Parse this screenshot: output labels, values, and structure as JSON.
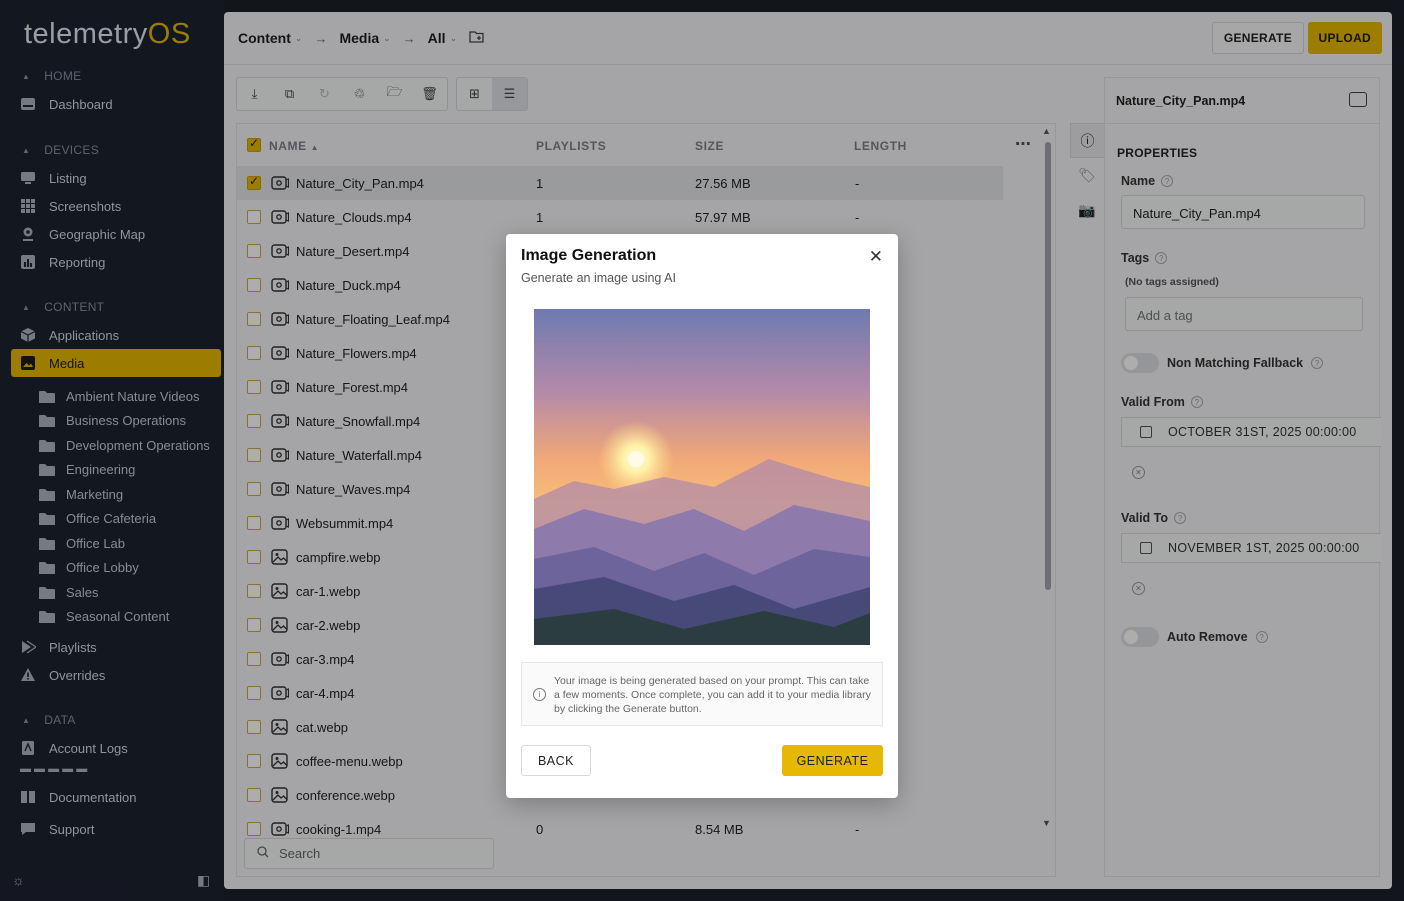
{
  "sidebar": {
    "logo_main": "telemetry",
    "logo_os": "OS",
    "sections": {
      "home": "HOME",
      "devices": "DEVICES",
      "content": "CONTENT",
      "data": "DATA"
    },
    "items": {
      "dashboard": "Dashboard",
      "listing": "Listing",
      "screenshots": "Screenshots",
      "geomap": "Geographic Map",
      "reporting": "Reporting",
      "applications": "Applications",
      "media": "Media",
      "playlists": "Playlists",
      "overrides": "Overrides",
      "account_logs": "Account Logs",
      "documentation": "Documentation",
      "support": "Support"
    },
    "folders": [
      "Ambient Nature Videos",
      "Business Operations",
      "Development Operations",
      "Engineering",
      "Marketing",
      "Office Cafeteria",
      "Office Lab",
      "Office Lobby",
      "Sales",
      "Seasonal Content"
    ]
  },
  "topbar": {
    "crumb_content": "Content",
    "crumb_media": "Media",
    "crumb_all": "All",
    "generate_label": "GENERATE",
    "upload_label": "UPLOAD"
  },
  "table": {
    "headers": {
      "name": "NAME",
      "playlists": "PLAYLISTS",
      "size": "SIZE",
      "length": "LENGTH"
    },
    "rows": [
      {
        "name": "Nature_City_Pan.mp4",
        "playlists": "1",
        "size": "27.56 MB",
        "length": "-",
        "type": "video",
        "selected": true
      },
      {
        "name": "Nature_Clouds.mp4",
        "playlists": "1",
        "size": "57.97 MB",
        "length": "-",
        "type": "video"
      },
      {
        "name": "Nature_Desert.mp4",
        "type": "video"
      },
      {
        "name": "Nature_Duck.mp4",
        "type": "video"
      },
      {
        "name": "Nature_Floating_Leaf.mp4",
        "type": "video"
      },
      {
        "name": "Nature_Flowers.mp4",
        "type": "video"
      },
      {
        "name": "Nature_Forest.mp4",
        "type": "video"
      },
      {
        "name": "Nature_Snowfall.mp4",
        "type": "video"
      },
      {
        "name": "Nature_Waterfall.mp4",
        "type": "video"
      },
      {
        "name": "Nature_Waves.mp4",
        "type": "video"
      },
      {
        "name": "Websummit.mp4",
        "type": "video"
      },
      {
        "name": "campfire.webp",
        "type": "image"
      },
      {
        "name": "car-1.webp",
        "type": "image"
      },
      {
        "name": "car-2.webp",
        "type": "image"
      },
      {
        "name": "car-3.mp4",
        "type": "video"
      },
      {
        "name": "car-4.mp4",
        "type": "video"
      },
      {
        "name": "cat.webp",
        "type": "image"
      },
      {
        "name": "coffee-menu.webp",
        "type": "image"
      },
      {
        "name": "conference.webp",
        "type": "image"
      },
      {
        "name": "cooking-1.mp4",
        "playlists": "0",
        "size": "8.54 MB",
        "length": "-",
        "type": "video"
      }
    ]
  },
  "search": {
    "placeholder": "Search"
  },
  "properties": {
    "file_title": "Nature_City_Pan.mp4",
    "section_title": "PROPERTIES",
    "name_label": "Name",
    "name_value": "Nature_City_Pan.mp4",
    "tags_label": "Tags",
    "no_tags": "(No tags assigned)",
    "add_tag_placeholder": "Add a tag",
    "non_matching_label": "Non Matching Fallback",
    "valid_from_label": "Valid From",
    "valid_from_value": "OCTOBER 31ST, 2025 00:00:00",
    "valid_to_label": "Valid To",
    "valid_to_value": "NOVEMBER 1ST, 2025 00:00:00",
    "auto_remove_label": "Auto Remove"
  },
  "modal": {
    "title": "Image Generation",
    "subtitle": "Generate an image using AI",
    "info_text": "Your image is being generated based on your prompt. This can take a few moments. Once complete, you can add it to your media library by clicking the Generate button.",
    "back_label": "BACK",
    "generate_label": "GENERATE"
  },
  "colors": {
    "accent": "#e6b800",
    "sidebar_bg": "#1d2230",
    "main_bg": "#f3f4f6"
  }
}
